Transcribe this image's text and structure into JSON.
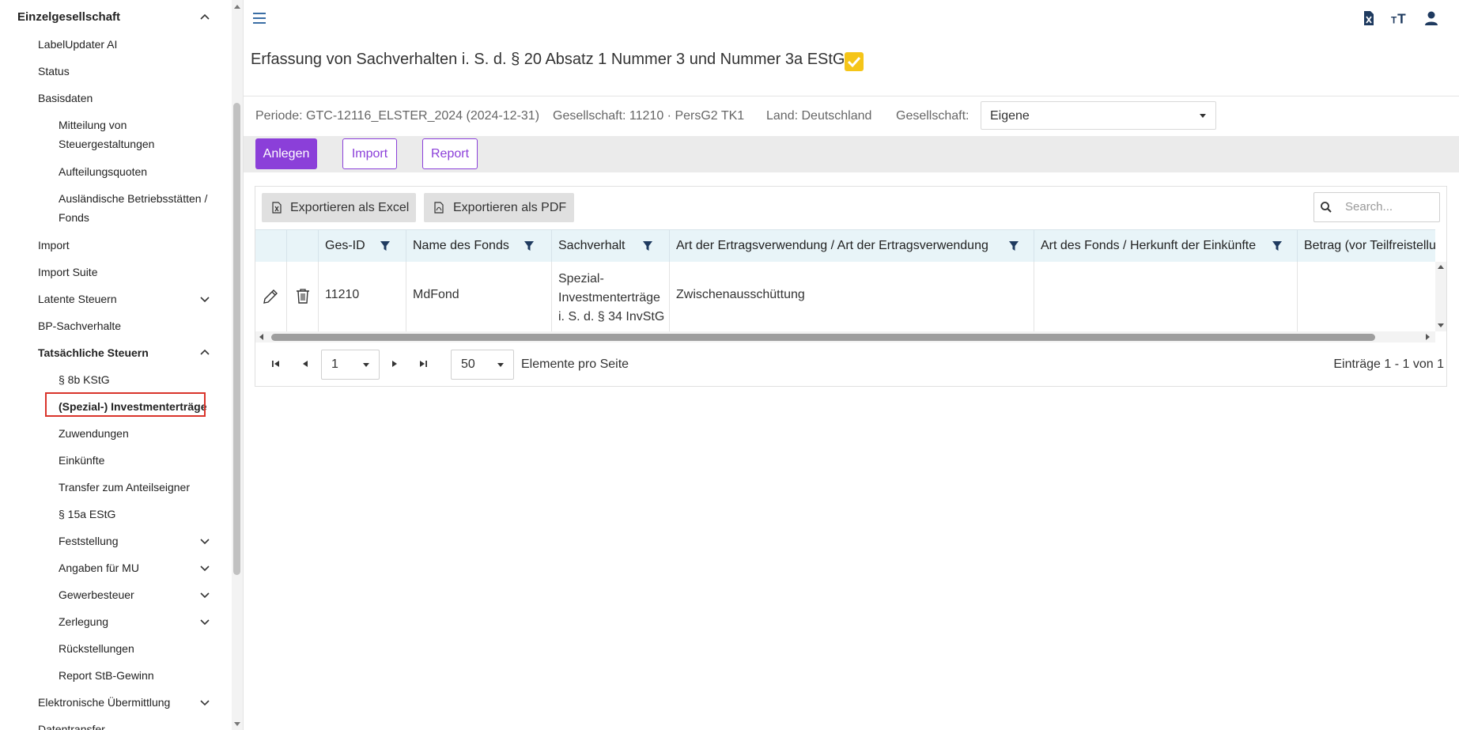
{
  "sidebar": {
    "items": [
      {
        "label": "Einzelgesellschaft",
        "level": 0,
        "chevron": "up"
      },
      {
        "label": "LabelUpdater AI",
        "level": 1
      },
      {
        "label": "Status",
        "level": 1
      },
      {
        "label": "Basisdaten",
        "level": 1
      },
      {
        "label": "Mitteilung von Steuergestaltungen",
        "level": 2
      },
      {
        "label": "Aufteilungsquoten",
        "level": 2
      },
      {
        "label": "Ausländische Betriebsstätten / Fonds",
        "level": 2
      },
      {
        "label": "Import",
        "level": 1
      },
      {
        "label": "Import Suite",
        "level": 1
      },
      {
        "label": "Latente Steuern",
        "level": 1,
        "chevron": "down"
      },
      {
        "label": "BP-Sachverhalte",
        "level": 1
      },
      {
        "label": "Tatsächliche Steuern",
        "level": 1,
        "chevron": "up"
      },
      {
        "label": "§ 8b KStG",
        "level": 2
      },
      {
        "label": "(Spezial-) Investmenterträge",
        "level": 2,
        "selected": true
      },
      {
        "label": "Zuwendungen",
        "level": 2
      },
      {
        "label": "Einkünfte",
        "level": 2
      },
      {
        "label": "Transfer zum Anteilseigner",
        "level": 2
      },
      {
        "label": "§ 15a EStG",
        "level": 2
      },
      {
        "label": "Feststellung",
        "level": 2,
        "chevron": "down"
      },
      {
        "label": "Angaben für MU",
        "level": 2,
        "chevron": "down"
      },
      {
        "label": "Gewerbesteuer",
        "level": 2,
        "chevron": "down"
      },
      {
        "label": "Zerlegung",
        "level": 2,
        "chevron": "down"
      },
      {
        "label": "Rückstellungen",
        "level": 2
      },
      {
        "label": "Report StB-Gewinn",
        "level": 2
      },
      {
        "label": "Elektronische Übermittlung",
        "level": 1,
        "chevron": "down"
      },
      {
        "label": "Datentransfer",
        "level": 1
      }
    ]
  },
  "topbar": {
    "icons": [
      "menu-icon",
      "excel-file-icon",
      "text-size-icon",
      "user-icon"
    ]
  },
  "page": {
    "title": "Erfassung von Sachverhalten i. S. d. § 20 Absatz 1 Nummer 3 und Nummer 3a EStG"
  },
  "info": {
    "periode": "Periode: GTC-12116_ELSTER_2024 (2024-12-31)",
    "gesellschaft": "Gesellschaft: 11210 · PersG2 TK1",
    "land": "Land: Deutschland",
    "gesellschaft_label": "Gesellschaft:",
    "gesellschaft_select": "Eigene"
  },
  "actions": {
    "anlegen": "Anlegen",
    "import": "Import",
    "report": "Report"
  },
  "grid": {
    "export_excel": "Exportieren als Excel",
    "export_pdf": "Exportieren als PDF",
    "search_placeholder": "Search...",
    "columns": [
      "Ges-ID",
      "Name des Fonds",
      "Sachverhalt",
      "Art der Ertragsverwendung / Art der Ertragsverwendung",
      "Art des Fonds / Herkunft der Einkünfte",
      "Betrag (vor Teilfreistellu"
    ],
    "rows": [
      {
        "ges_id": "11210",
        "name": "MdFond",
        "sachverhalt_lines": [
          "Spezial-",
          "Investmenterträge",
          "i. S. d. § 34 InvStG"
        ],
        "ertragsverwendung": "Zwischenausschüttung",
        "art_fonds": "",
        "betrag": ""
      }
    ]
  },
  "pager": {
    "page": "1",
    "page_size": "50",
    "per_page_label": "Elemente pro Seite",
    "summary": "Einträge 1 - 1 von 1"
  },
  "colors": {
    "accent": "#8b3fd9",
    "header_bg": "#e8f4f8",
    "highlight_border": "#d9342b",
    "check_badge": "#f5c518"
  }
}
